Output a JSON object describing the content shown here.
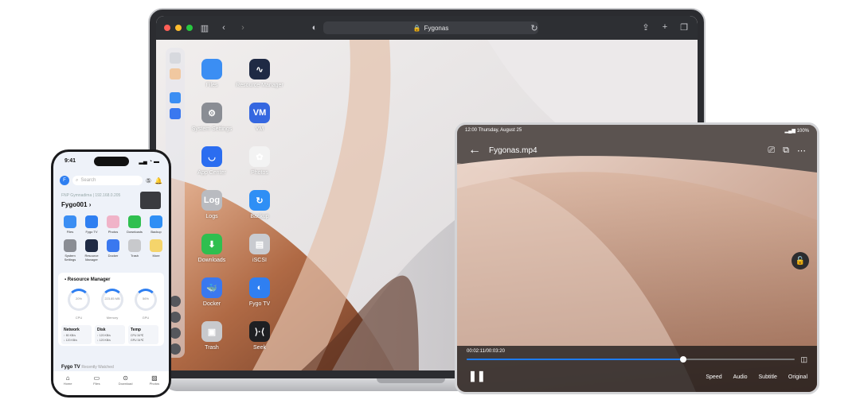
{
  "browser": {
    "url": "Fygonas",
    "lock_icon": "lock-icon",
    "colors": {
      "red": "#ff5f57",
      "yellow": "#febc2e",
      "green": "#28c840"
    }
  },
  "desktop": {
    "apps": [
      {
        "label": "Files",
        "color": "#3b8ef3",
        "glyph": ""
      },
      {
        "label": "Resource Manager",
        "color": "#1f2a44",
        "glyph": "∿"
      },
      {
        "label": "System Settings",
        "color": "#8a8d94",
        "glyph": "⚙"
      },
      {
        "label": "VM",
        "color": "#3567e0",
        "glyph": "VM"
      },
      {
        "label": "App Center",
        "color": "#2b6df0",
        "glyph": "◡"
      },
      {
        "label": "Photos",
        "color": "#f3f3f3",
        "glyph": "✿"
      },
      {
        "label": "Logs",
        "color": "#b9bbc0",
        "glyph": "Log"
      },
      {
        "label": "Backup",
        "color": "#2f8ff5",
        "glyph": "↻"
      },
      {
        "label": "Downloads",
        "color": "#2fbf4f",
        "glyph": "⬇"
      },
      {
        "label": "iSCSI",
        "color": "#c9cbd0",
        "glyph": "▤"
      },
      {
        "label": "Docker",
        "color": "#3a78ef",
        "glyph": "🐳"
      },
      {
        "label": "Fygo TV",
        "color": "#2f7ff1",
        "glyph": "◐"
      },
      {
        "label": "Trash",
        "color": "#c8c9cc",
        "glyph": "▣"
      },
      {
        "label": "Seek",
        "color": "#1e1f22",
        "glyph": "⟩·⟨"
      }
    ]
  },
  "tablet": {
    "status_time": "12:00  Thursday, August 25",
    "status_right": "100%",
    "title": "Fygonas.mp4",
    "time": "00:02:11/00:03:20",
    "progress": 0.66,
    "controls": [
      "Speed",
      "Audio",
      "Subtitle",
      "Original"
    ]
  },
  "phone": {
    "time": "9:41",
    "search_placeholder": "Search",
    "avatar_letter": "F",
    "device_line": "FNP Gymnadima | 192.168.0.205",
    "device_name": "Fygo001",
    "apps": [
      {
        "label": "Files",
        "color": "#3b8ef3"
      },
      {
        "label": "Fygo TV",
        "color": "#2f7ff1"
      },
      {
        "label": "Photos",
        "color": "#f0b3c8"
      },
      {
        "label": "Downloads",
        "color": "#2fbf4f"
      },
      {
        "label": "Backup",
        "color": "#2f8ff5"
      },
      {
        "label": "System Settings",
        "color": "#8a8d94"
      },
      {
        "label": "Resource Manager",
        "color": "#1f2a44"
      },
      {
        "label": "Docker",
        "color": "#3a78ef"
      },
      {
        "label": "Trash",
        "color": "#c8c9cc"
      },
      {
        "label": "More",
        "color": "#f5d46b"
      }
    ],
    "resource_title": "Resource Manager",
    "gauges": [
      {
        "value": "20%",
        "label": "CPU"
      },
      {
        "value": "223.85 MB",
        "label": "Memory"
      },
      {
        "value": "56%",
        "label": "GPU"
      }
    ],
    "stats": [
      {
        "title": "Network",
        "r1": "↑ 80 KB/s",
        "r2": "↓ 120 KB/s"
      },
      {
        "title": "Disk",
        "r1": "↑ 120 KB/s",
        "r2": "↓ 120 KB/s"
      },
      {
        "title": "Temp",
        "r1": "CPU 34℃",
        "r2": "GPU 34℃"
      }
    ],
    "fygo_tv": "Fygo TV",
    "recently": "Recently Watched",
    "tabs": [
      {
        "label": "Home",
        "glyph": "⌂"
      },
      {
        "label": "Files",
        "glyph": "▭"
      },
      {
        "label": "Download",
        "glyph": "⊙"
      },
      {
        "label": "Photos",
        "glyph": "▨"
      }
    ]
  }
}
